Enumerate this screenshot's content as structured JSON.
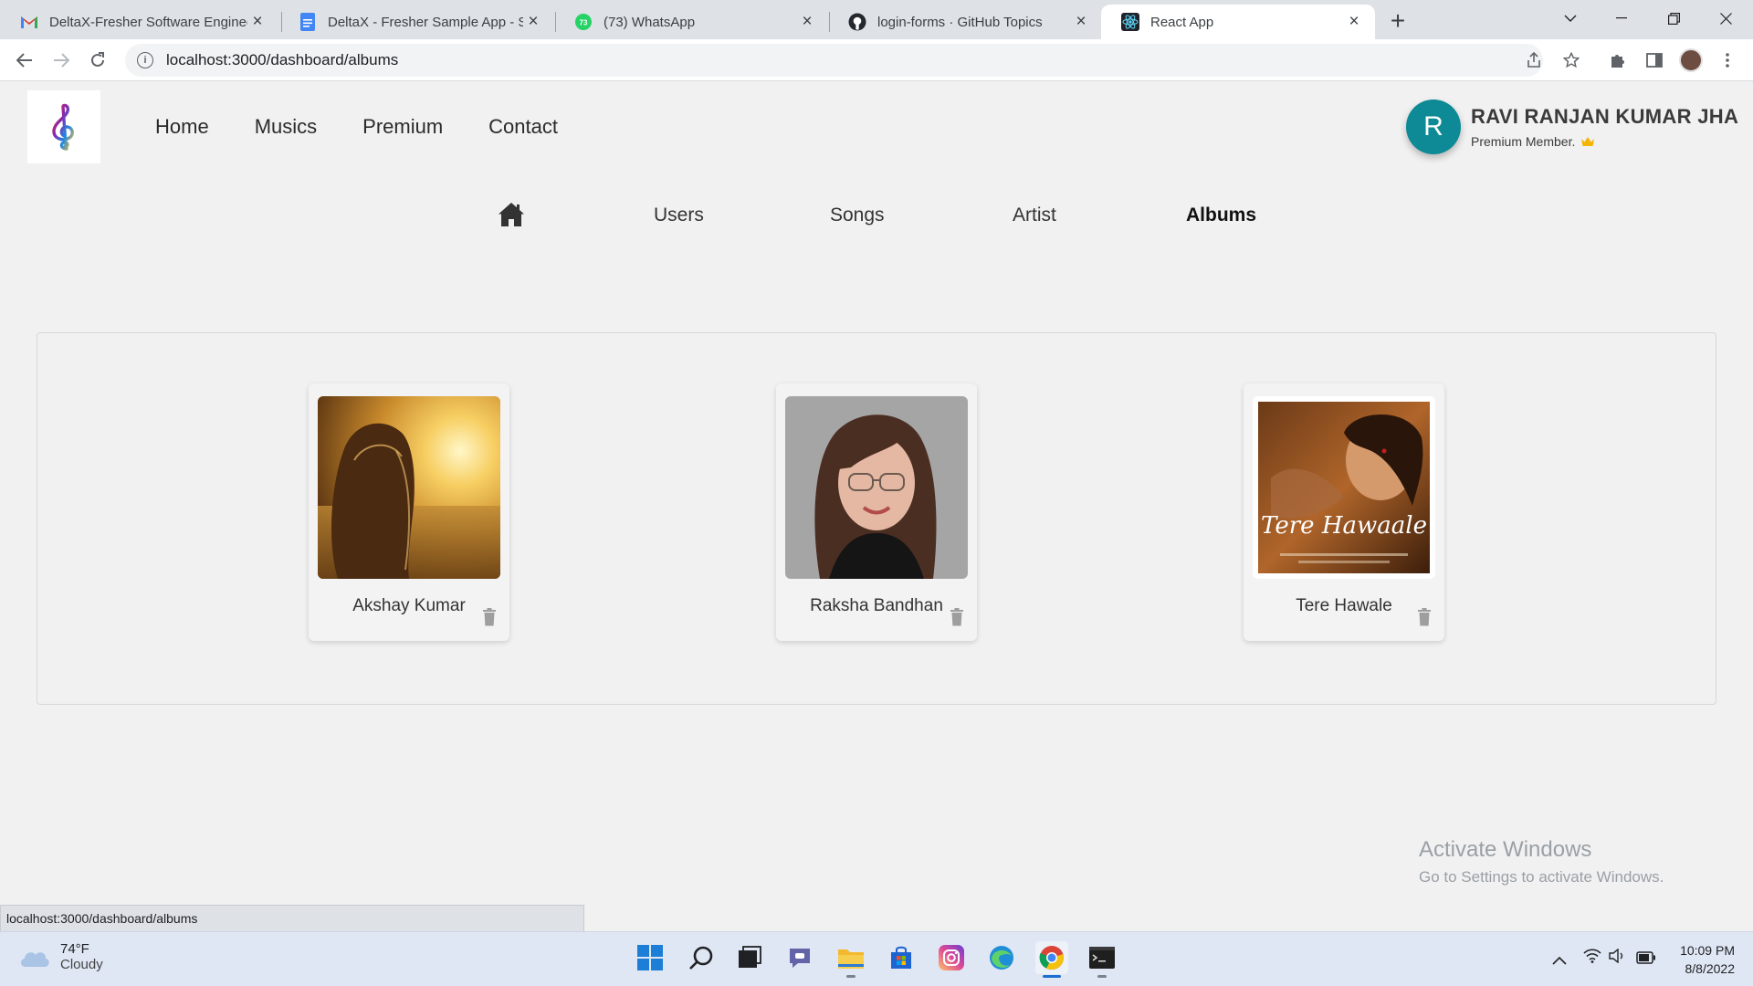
{
  "browser": {
    "tabs": [
      {
        "title": "DeltaX-Fresher Software Enginee",
        "icon": "gmail-icon"
      },
      {
        "title": "DeltaX - Fresher Sample App - Sp",
        "icon": "docs-icon"
      },
      {
        "title": "(73) WhatsApp",
        "icon": "whatsapp-icon",
        "badge": "73"
      },
      {
        "title": "login-forms · GitHub Topics",
        "icon": "github-icon"
      },
      {
        "title": "React App",
        "icon": "react-icon",
        "active": true
      }
    ],
    "url": "localhost:3000/dashboard/albums",
    "status_url": "localhost:3000/dashboard/albums"
  },
  "header": {
    "nav": [
      "Home",
      "Musics",
      "Premium",
      "Contact"
    ],
    "user": {
      "initial": "R",
      "name": "RAVI RANJAN KUMAR JHA",
      "membership": "Premium Member.",
      "avatar_color": "#0d8a96"
    }
  },
  "subnav": {
    "items": [
      "Users",
      "Songs",
      "Artist",
      "Albums"
    ],
    "active": "Albums"
  },
  "albums": [
    {
      "name": "Akshay Kumar",
      "image": "sunset-field-photo"
    },
    {
      "name": "Raksha Bandhan",
      "image": "woman-portrait-photo"
    },
    {
      "name": "Tere Hawale",
      "image": "tere-hawaale-poster",
      "poster_text": "Tere Hawaale"
    }
  ],
  "watermark": {
    "line1": "Activate Windows",
    "line2": "Go to Settings to activate Windows."
  },
  "taskbar": {
    "weather": {
      "temp": "74°F",
      "condition": "Cloudy"
    },
    "time": "10:09 PM",
    "date": "8/8/2022"
  },
  "colors": {
    "page_bg": "#f2f1f1",
    "avatar": "#0d8a96",
    "crown": "#f4b400"
  }
}
